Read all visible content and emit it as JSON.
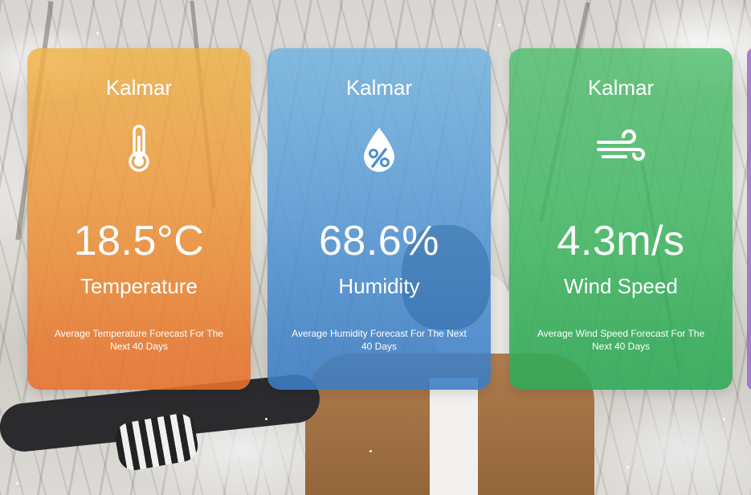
{
  "cards": [
    {
      "city": "Kalmar",
      "icon": "thermometer-icon",
      "value": "18.5°C",
      "label": "Temperature",
      "description": "Average Temperature Forecast For The Next 40 Days",
      "color": "#ec8c34"
    },
    {
      "city": "Kalmar",
      "icon": "humidity-drop-icon",
      "value": "68.6%",
      "label": "Humidity",
      "description": "Average Humidity Forecast For The Next 40 Days",
      "color": "#4c90d2"
    },
    {
      "city": "Kalmar",
      "icon": "wind-icon",
      "value": "4.3m/s",
      "label": "Wind Speed",
      "description": "Average Wind Speed Forecast For The Next 40 Days",
      "color": "#3cb45f"
    }
  ]
}
